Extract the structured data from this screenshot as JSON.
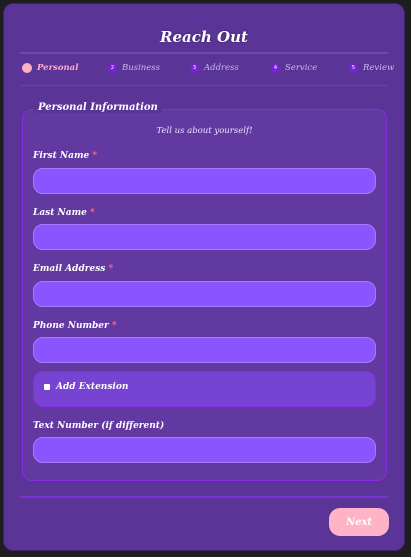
{
  "form": {
    "title": "Reach Out",
    "steps": [
      {
        "label": "Personal",
        "number": "1",
        "active": true
      },
      {
        "label": "Business",
        "number": "2",
        "active": false
      },
      {
        "label": "Address",
        "number": "3",
        "active": false
      },
      {
        "label": "Service",
        "number": "4",
        "active": false
      },
      {
        "label": "Review",
        "number": "5",
        "active": false
      }
    ],
    "section": {
      "legend": "Personal Information",
      "subtitle": "Tell us about yourself!"
    },
    "fields": {
      "first_name": {
        "label": "First Name",
        "required_mark": "*",
        "value": ""
      },
      "last_name": {
        "label": "Last Name",
        "required_mark": "*",
        "value": ""
      },
      "email": {
        "label": "Email Address",
        "required_mark": "*",
        "value": ""
      },
      "phone": {
        "label": "Phone Number",
        "required_mark": "*",
        "value": ""
      },
      "extension": {
        "label": "Add Extension",
        "checked": false
      },
      "text_number": {
        "label": "Text Number (if different)",
        "value": ""
      }
    },
    "next_label": "Next"
  },
  "colors": {
    "background": "#1e1e1e",
    "panel": "#5a3497",
    "fieldset_border": "#8a2be2",
    "input": "#8c54ff",
    "accent_pink": "#ffb3c6",
    "required": "#ff6b8a"
  }
}
